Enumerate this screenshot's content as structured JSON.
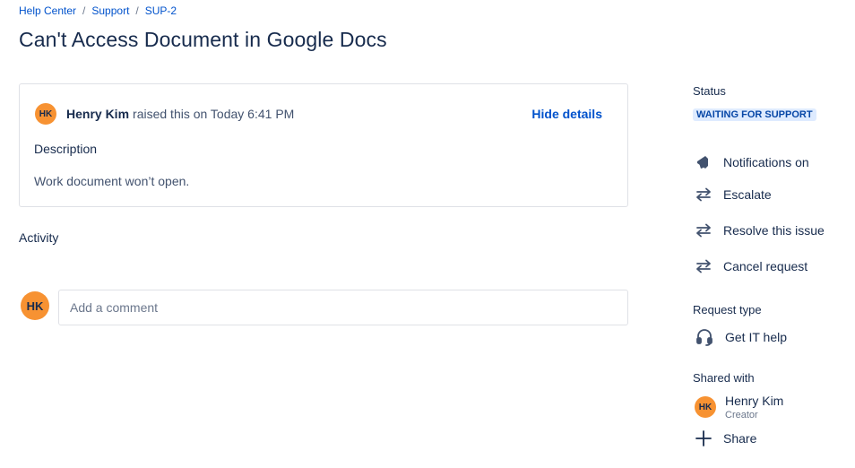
{
  "breadcrumb": {
    "items": [
      "Help Center",
      "Support",
      "SUP-2"
    ],
    "separator": "/"
  },
  "title": "Can't Access Document in Google Docs",
  "request": {
    "reporter_initials": "HK",
    "reporter_name": "Henry Kim",
    "raised_text": "raised this on Today 6:41 PM",
    "hide_details_label": "Hide details",
    "description_heading": "Description",
    "description_body": "Work document won’t open."
  },
  "activity": {
    "heading": "Activity",
    "user_initials": "HK",
    "comment_placeholder": "Add a comment"
  },
  "sidebar": {
    "status_heading": "Status",
    "status_value": "WAITING FOR SUPPORT",
    "actions": [
      {
        "label": "Notifications on",
        "icon": "megaphone-icon"
      },
      {
        "label": "Escalate",
        "icon": "transition-arrows-icon"
      },
      {
        "label": "Resolve this issue",
        "icon": "transition-arrows-icon"
      },
      {
        "label": "Cancel request",
        "icon": "transition-arrows-icon"
      }
    ],
    "request_type_heading": "Request type",
    "request_type_value": "Get IT help",
    "request_type_icon": "headset-icon",
    "shared_with_heading": "Shared with",
    "shared_user_initials": "HK",
    "shared_user_name": "Henry Kim",
    "shared_user_role": "Creator",
    "share_label": "Share",
    "share_icon": "plus-icon"
  },
  "colors": {
    "link": "#0052cc",
    "avatar": "#f79232",
    "status_bg": "#deebff",
    "status_text": "#0747a6",
    "text": "#172b4d",
    "border": "#dfe1e6"
  }
}
